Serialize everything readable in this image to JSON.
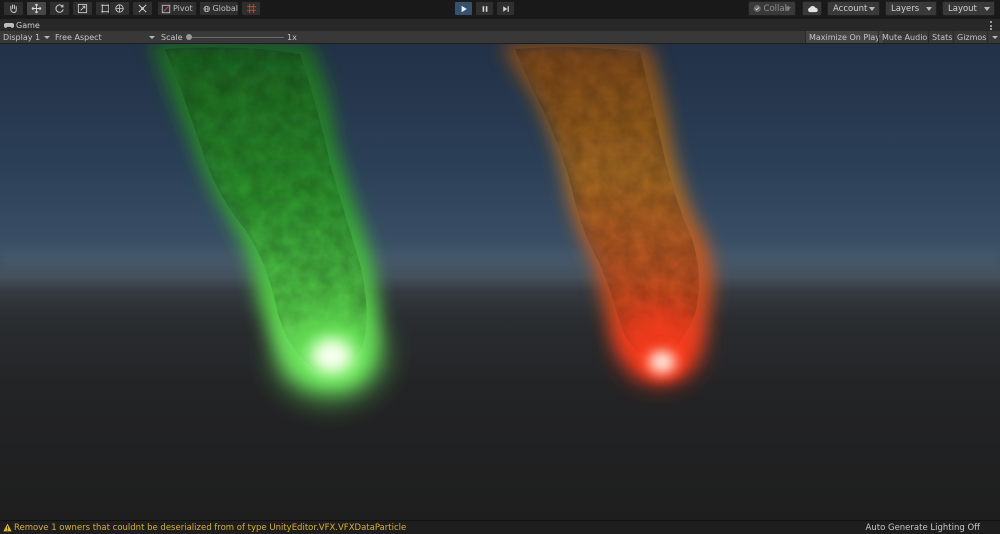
{
  "toolbar": {
    "pivot_label": "Pivot",
    "global_label": "Global",
    "collab_label": "Collab",
    "account_label": "Account",
    "layers_label": "Layers",
    "layout_label": "Layout"
  },
  "tab": {
    "title": "Game"
  },
  "game_view": {
    "display": "Display 1",
    "aspect": "Free Aspect",
    "scale_label": "Scale",
    "scale_value": "1x",
    "maximize_on_play": "Maximize On Play",
    "mute_audio": "Mute Audio",
    "stats": "Stats",
    "gizmos": "Gizmos"
  },
  "status": {
    "message": "Remove 1 owners that couldnt be deserialized from  of type UnityEditor.VFX.VFXDataParticle",
    "right": "Auto Generate Lighting Off"
  },
  "colors": {
    "accent_play": "#35516e",
    "warning": "#d8b037",
    "smoke_green": "#3fd13a",
    "smoke_orange": "#c8721c",
    "smoke_red": "#ff3a1c"
  }
}
